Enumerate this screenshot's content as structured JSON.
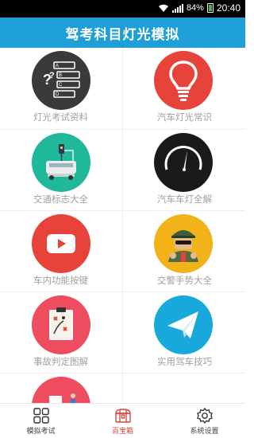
{
  "status_bar": {
    "battery": "84%",
    "time": "20:40"
  },
  "header": {
    "title": "驾考科目灯光模拟"
  },
  "grid": [
    {
      "label": "灯光考试资料",
      "icon": "question-list-icon",
      "color": "#3a3a3a"
    },
    {
      "label": "汽车灯光常识",
      "icon": "lightbulb-icon",
      "color": "#e8433a"
    },
    {
      "label": "交通标志大全",
      "icon": "bus-icon",
      "color": "#1fb89a"
    },
    {
      "label": "汽车车灯全解",
      "icon": "gauge-icon",
      "color": "#1a1a1a"
    },
    {
      "label": "车内功能按键",
      "icon": "play-button-icon",
      "color": "#e8433a"
    },
    {
      "label": "交警手势大全",
      "icon": "police-officer-icon",
      "color": "#f2b31a"
    },
    {
      "label": "事故判定图解",
      "icon": "clipboard-icon",
      "color": "#ee4d5f"
    },
    {
      "label": "实用驾车技巧",
      "icon": "paper-plane-icon",
      "color": "#18a9dc"
    },
    {
      "label": "",
      "icon": "partial-icon",
      "color": "#ee4d5f"
    }
  ],
  "tabs": [
    {
      "label": "模拟考试",
      "icon": "grid-icon"
    },
    {
      "label": "百宝箱",
      "icon": "treasure-box-icon"
    },
    {
      "label": "系统设置",
      "icon": "settings-gear-icon"
    }
  ]
}
